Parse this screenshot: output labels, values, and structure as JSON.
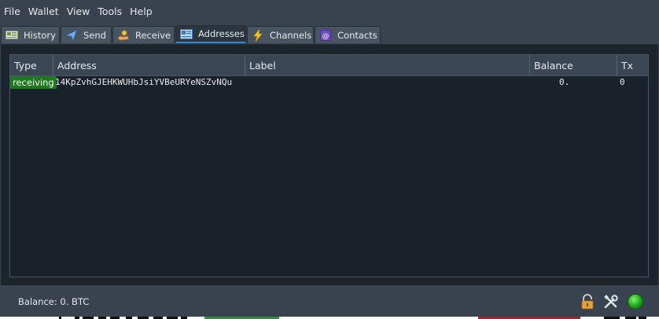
{
  "menu": {
    "items": [
      "File",
      "Wallet",
      "View",
      "Tools",
      "Help"
    ]
  },
  "tabs": [
    {
      "label": "History",
      "icon": "history-icon"
    },
    {
      "label": "Send",
      "icon": "send-icon"
    },
    {
      "label": "Receive",
      "icon": "receive-icon"
    },
    {
      "label": "Addresses",
      "icon": "addresses-icon",
      "active": true
    },
    {
      "label": "Channels",
      "icon": "lightning-icon"
    },
    {
      "label": "Contacts",
      "icon": "contacts-icon"
    }
  ],
  "table": {
    "columns": [
      "Type",
      "Address",
      "Label",
      "Balance",
      "Tx"
    ],
    "rows": [
      {
        "type": "receiving",
        "address": "14KpZvhGJEHKWUHbJsiYVBeURYeNSZvNQu",
        "label": "",
        "balance": "0.",
        "tx": "0"
      }
    ]
  },
  "status": {
    "balance_text": "Balance: 0. BTC"
  },
  "colors": {
    "accent": "#2f87d9",
    "receiving": "#1c7a1c",
    "status_ok": "#22b222"
  }
}
